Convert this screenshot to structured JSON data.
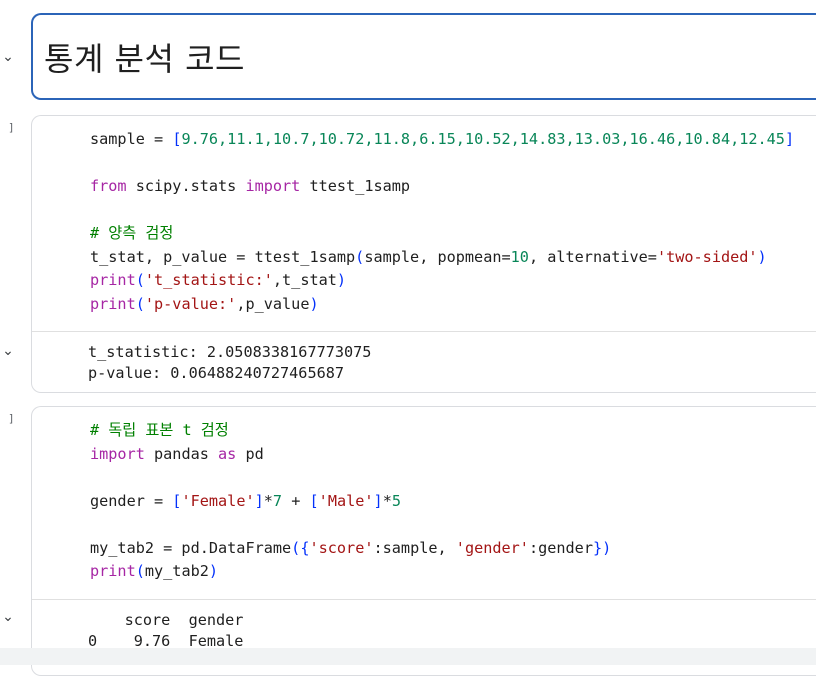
{
  "markdown_cell": {
    "title": "통계 분석 코드"
  },
  "cell1": {
    "bracket": "]",
    "code": {
      "sample_var": "sample",
      "eq": " = ",
      "sample_open": "[",
      "sample_values": "9.76,11.1,10.7,10.72,11.8,6.15,10.52,14.83,13.03,16.46,10.84,12.45",
      "sample_close": "]",
      "from_kw": "from",
      "module": " scipy.stats ",
      "import_kw": "import",
      "imported": " ttest_1samp",
      "comment": "# 양측 검정",
      "line4_pre": "t_stat, p_value = ttest_1samp",
      "paren_open": "(",
      "line4_args1": "sample, popmean=",
      "popmean": "10",
      "line4_args2": ", alternative=",
      "alternative": "'two-sided'",
      "paren_close": ")",
      "print_kw": "print",
      "p1_str": "'t_statistic:'",
      "p1_rest": ",t_stat",
      "p2_str": "'p-value:'",
      "p2_rest": ",p_value"
    },
    "output": {
      "line1": "t_statistic: 2.0508338167773075",
      "line2": "p-value: 0.06488240727465687"
    }
  },
  "cell2": {
    "bracket": "]",
    "code": {
      "comment": "# 독립 표본 t 검정",
      "import_kw": "import",
      "pandas": " pandas ",
      "as_kw": "as",
      "alias": " pd",
      "gender_pre": "gender = ",
      "female_str": "'Female'",
      "times": "*",
      "seven": "7",
      "plus": " + ",
      "male_str": "'Male'",
      "five": "5",
      "tab_pre": "my_tab2 = pd.DataFrame",
      "brace_open": "{",
      "score_key": "'score'",
      "score_val": ":sample, ",
      "gender_key": "'gender'",
      "gender_val": ":gender",
      "brace_close": "}",
      "print_kw": "print",
      "print_arg": "my_tab2"
    },
    "output": {
      "header": "    score  gender",
      "row0": "0    9.76  Female"
    }
  },
  "icons": {
    "collapse": "chevron-down-icon"
  }
}
